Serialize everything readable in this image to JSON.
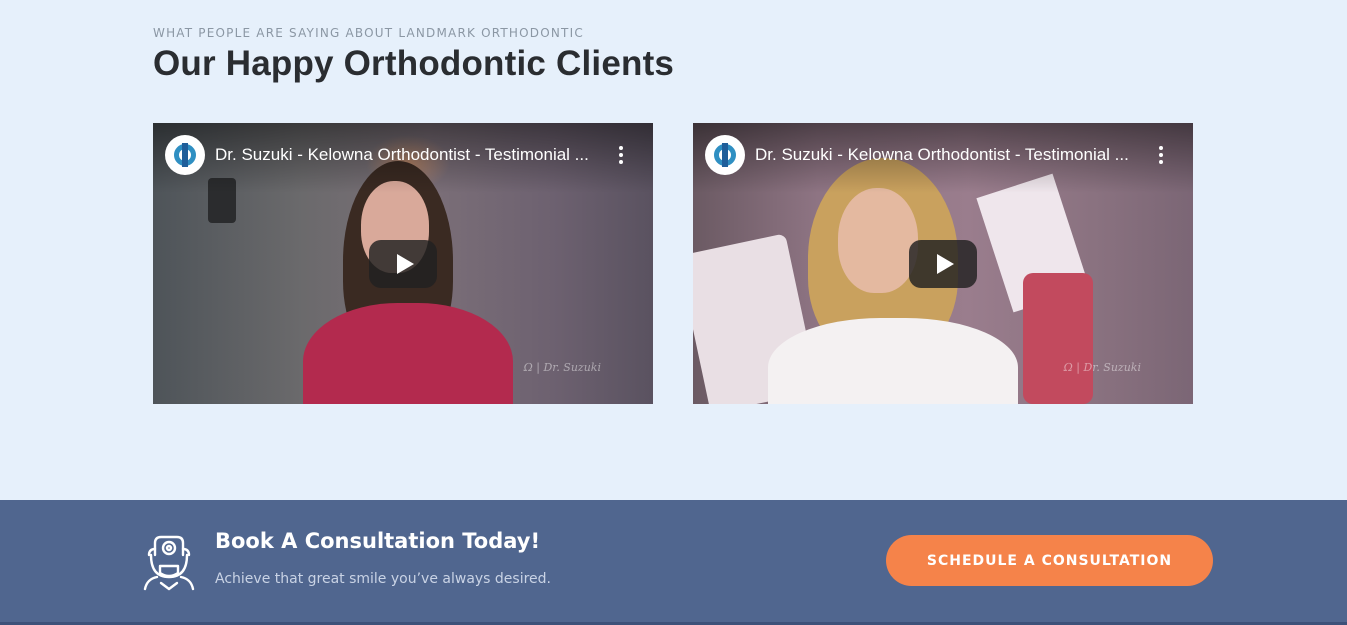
{
  "testimonials": {
    "eyebrow": "WHAT PEOPLE ARE SAYING ABOUT LANDMARK ORTHODONTIC",
    "heading": "Our Happy Orthodontic Clients",
    "videos": [
      {
        "title": "Dr. Suzuki - Kelowna Orthodontist - Testimonial ...",
        "watermark": "Ω | Dr. Suzuki",
        "channel_icon": "channel-logo-icon"
      },
      {
        "title": "Dr. Suzuki - Kelowna Orthodontist - Testimonial ...",
        "watermark": "Ω | Dr. Suzuki",
        "channel_icon": "channel-logo-icon"
      }
    ]
  },
  "cta": {
    "icon": "orthodontist-icon",
    "title": "Book A Consultation Today!",
    "subtitle": "Achieve that great smile you’ve always desired.",
    "button_label": "SCHEDULE A CONSULTATION"
  },
  "colors": {
    "page_bg": "#e6f0fb",
    "cta_bg": "#50668f",
    "button": "#f5834a",
    "heading": "#2a2d31"
  }
}
